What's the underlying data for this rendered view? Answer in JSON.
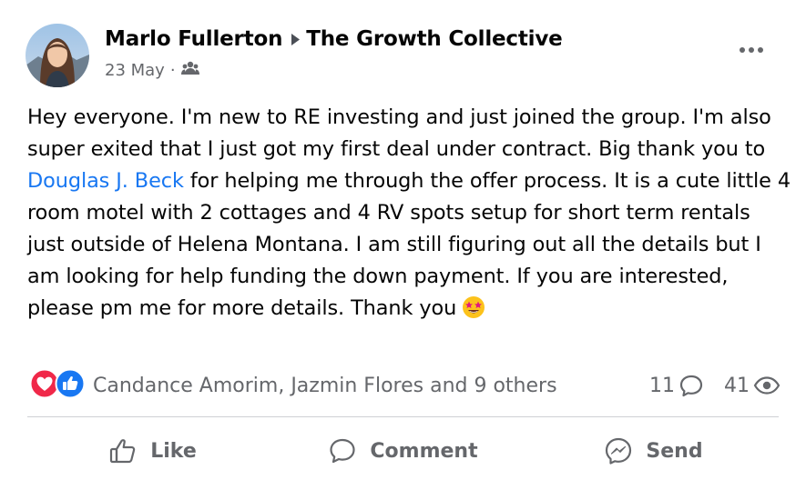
{
  "post": {
    "author": "Marlo Fullerton",
    "group": "The Growth Collective",
    "date": "23 May",
    "separator": "·",
    "privacy_icon": "group-icon",
    "text_before_mention": "Hey everyone. I'm new to RE investing and just joined the group. I'm also super exited that I just got my first deal under contract. Big thank you to ",
    "mention": "Douglas J. Beck",
    "text_after_mention": " for helping me through the offer process. It is a cute little 4 room motel with 2 cottages and 4 RV spots setup for short term rentals just outside of Helena Montana. I am still figuring out all the details but I am looking for help funding the down payment. If you are interested, please pm me for more details. Thank you",
    "emoji": "star-struck-emoji"
  },
  "reactions": {
    "icons": [
      "love-reaction-icon",
      "like-reaction-icon"
    ],
    "names": "Candance Amorim, Jazmin Flores and 9 others",
    "comment_count": "11",
    "view_count": "41"
  },
  "actions": {
    "like": "Like",
    "comment": "Comment",
    "send": "Send"
  },
  "colors": {
    "link": "#1877f2",
    "secondary_text": "#65676b",
    "love": "#f02849",
    "like": "#1877f2"
  }
}
